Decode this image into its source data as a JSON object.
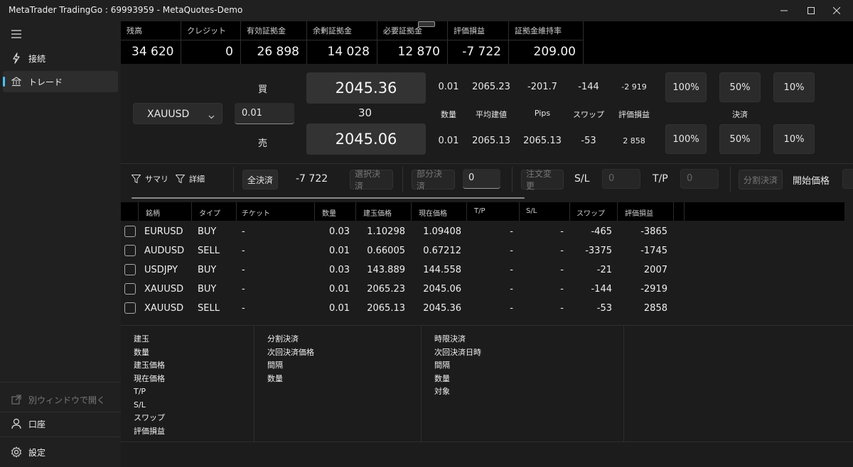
{
  "window": {
    "title": "MetaTrader TradingGo : 69993959 - MetaQuotes-Demo"
  },
  "sidebar": {
    "items": [
      {
        "label": "接続"
      },
      {
        "label": "トレード"
      }
    ],
    "bottom": [
      {
        "label": "別ウィンドウで開く"
      },
      {
        "label": "口座"
      },
      {
        "label": "設定"
      }
    ]
  },
  "account": [
    {
      "label": "残高",
      "value": "34 620"
    },
    {
      "label": "クレジット",
      "value": "0"
    },
    {
      "label": "有効証拠金",
      "value": "26 898"
    },
    {
      "label": "余剰証拠金",
      "value": "14 028"
    },
    {
      "label": "必要証拠金",
      "value": "12 870"
    },
    {
      "label": "評価損益",
      "value": "-7 722"
    },
    {
      "label": "証拠金維持率",
      "value": "209.00"
    }
  ],
  "trade": {
    "symbol": "XAUUSD",
    "volume": "0.01",
    "buy_label": "買",
    "sell_label": "売",
    "bid_price": "2045.36",
    "ask_price": "2045.06",
    "spread": "30",
    "buy_row": {
      "volume": "0.01",
      "avg_price": "2065.23",
      "pips": "-201.7",
      "swap": "-144",
      "pnl": "-2 919"
    },
    "headers": {
      "volume": "数量",
      "avg_price": "平均建値",
      "pips": "Pips",
      "swap": "スワップ",
      "pnl": "評価損益",
      "close": "決済"
    },
    "sell_row": {
      "volume": "0.01",
      "avg_price": "2065.13",
      "pips": "2065.13",
      "swap": "-53",
      "pnl": "2 858"
    },
    "pct_buttons": [
      "100%",
      "50%",
      "10%"
    ]
  },
  "toolbar": {
    "summary": "サマリ",
    "detail": "詳細",
    "close_all": "全決済",
    "total": "-7 722",
    "close_selected": "選択決済",
    "partial_close": "部分決済",
    "partial_value": "0",
    "modify": "注文変更",
    "sl_label": "S/L",
    "sl_value": "0",
    "tp_label": "T/P",
    "tp_value": "0",
    "split_close": "分割決済",
    "open_price": "開始価格"
  },
  "positions": {
    "columns": [
      "銘柄",
      "タイプ",
      "チケット",
      "数量",
      "建玉価格",
      "現在価格",
      "T/P",
      "S/L",
      "スワップ",
      "評価損益"
    ],
    "rows": [
      {
        "symbol": "EURUSD",
        "type": "BUY",
        "ticket": "-",
        "volume": "0.03",
        "open": "1.10298",
        "current": "1.09408",
        "tp": "-",
        "sl": "-",
        "swap": "-465",
        "pnl": "-3865"
      },
      {
        "symbol": "AUDUSD",
        "type": "SELL",
        "ticket": "-",
        "volume": "0.01",
        "open": "0.66005",
        "current": "0.67212",
        "tp": "-",
        "sl": "-",
        "swap": "-3375",
        "pnl": "-1745"
      },
      {
        "symbol": "USDJPY",
        "type": "BUY",
        "ticket": "-",
        "volume": "0.03",
        "open": "143.889",
        "current": "144.558",
        "tp": "-",
        "sl": "-",
        "swap": "-21",
        "pnl": "2007"
      },
      {
        "symbol": "XAUUSD",
        "type": "BUY",
        "ticket": "-",
        "volume": "0.01",
        "open": "2065.23",
        "current": "2045.06",
        "tp": "-",
        "sl": "-",
        "swap": "-144",
        "pnl": "-2919"
      },
      {
        "symbol": "XAUUSD",
        "type": "SELL",
        "ticket": "-",
        "volume": "0.01",
        "open": "2065.13",
        "current": "2045.36",
        "tp": "-",
        "sl": "-",
        "swap": "-53",
        "pnl": "2858"
      }
    ]
  },
  "info": {
    "col1": [
      "建玉",
      "数量",
      "建玉価格",
      "現在価格",
      "T/P",
      "S/L",
      "スワップ",
      "評価損益"
    ],
    "col2": [
      "分割決済",
      "次回決済価格",
      "間隔",
      "数量"
    ],
    "col3": [
      "時限決済",
      "次回決済日時",
      "間隔",
      "数量",
      "対象"
    ]
  },
  "colors": {
    "accent": "#4cc2ff",
    "background": "#1c1c1c",
    "header_bg": "#000000"
  },
  "icons": [
    "menu-icon",
    "plug-icon",
    "bank-icon",
    "open-window-icon",
    "person-icon",
    "gear-icon",
    "filter-icon",
    "chevron-down-icon"
  ]
}
